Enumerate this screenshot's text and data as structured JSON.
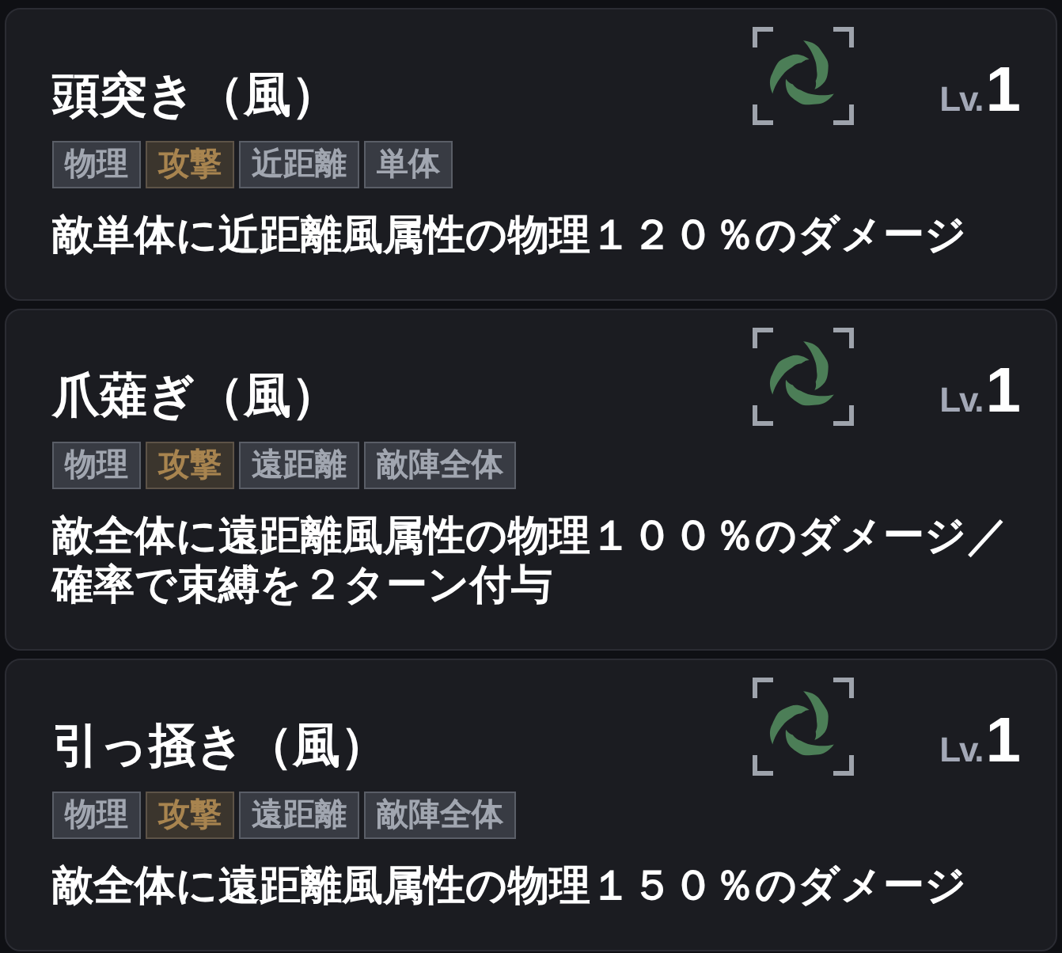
{
  "cards": [
    {
      "title": "頭突き（風）",
      "lv_prefix": "Lv.",
      "lv_value": "1",
      "tags": [
        {
          "label": "物理",
          "kind": "plain"
        },
        {
          "label": "攻撃",
          "kind": "accent"
        },
        {
          "label": "近距離",
          "kind": "plain"
        },
        {
          "label": "単体",
          "kind": "plain"
        }
      ],
      "description": "敵単体に近距離風属性の物理１２０％のダメージ"
    },
    {
      "title": "爪薙ぎ（風）",
      "lv_prefix": "Lv.",
      "lv_value": "1",
      "tags": [
        {
          "label": "物理",
          "kind": "plain"
        },
        {
          "label": "攻撃",
          "kind": "accent"
        },
        {
          "label": "遠距離",
          "kind": "plain"
        },
        {
          "label": "敵陣全体",
          "kind": "plain"
        }
      ],
      "description": "敵全体に遠距離風属性の物理１００％のダメージ／確率で束縛を２ターン付与"
    },
    {
      "title": "引っ掻き（風）",
      "lv_prefix": "Lv.",
      "lv_value": "1",
      "tags": [
        {
          "label": "物理",
          "kind": "plain"
        },
        {
          "label": "攻撃",
          "kind": "accent"
        },
        {
          "label": "遠距離",
          "kind": "plain"
        },
        {
          "label": "敵陣全体",
          "kind": "plain"
        }
      ],
      "description": "敵全体に遠距離風属性の物理１５０％のダメージ"
    }
  ]
}
